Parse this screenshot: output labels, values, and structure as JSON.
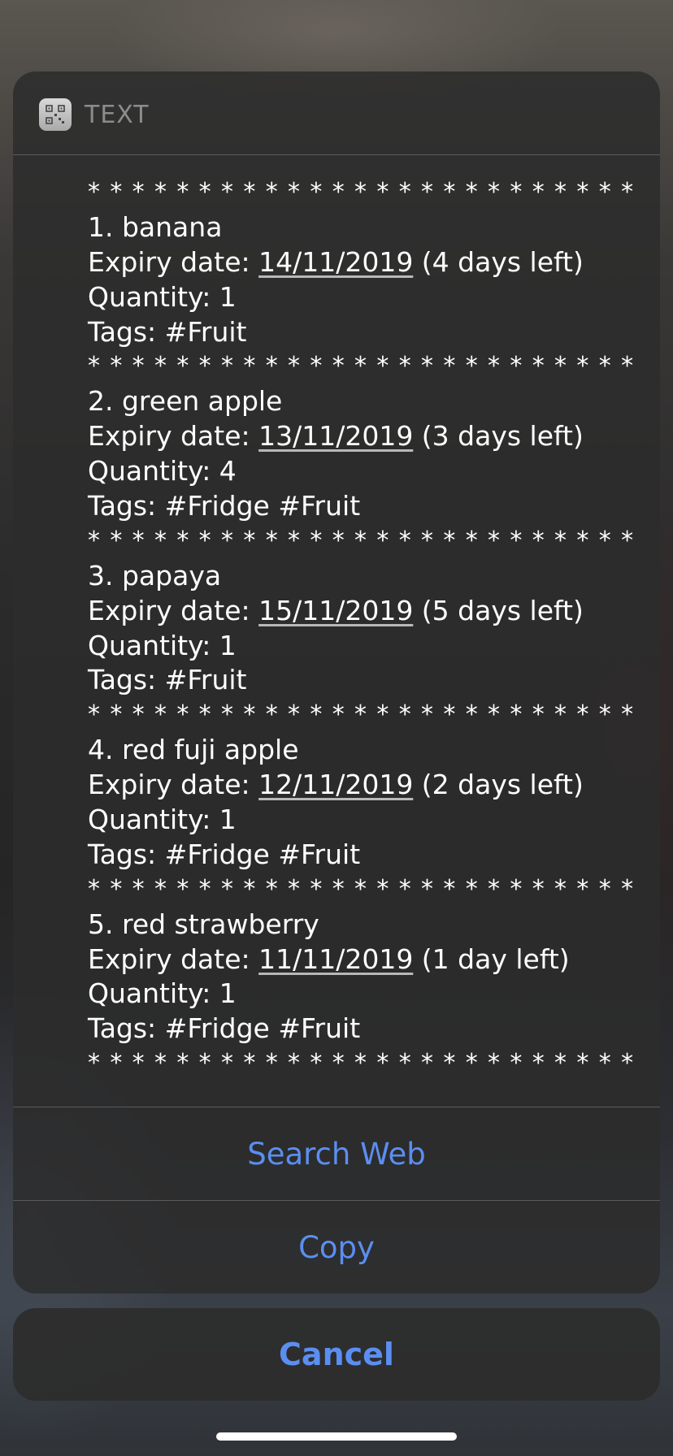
{
  "header": {
    "app_icon": "qr-code-icon",
    "title": "TEXT"
  },
  "separator": "* * * * * * * * * * * * * * * * * * * * * * * * *",
  "items": [
    {
      "name": "1. banana",
      "expiry_label": "Expiry date: ",
      "date": "14/11/2019",
      "left": " (4 days left)",
      "quantity": "Quantity: 1",
      "tags": "Tags: #Fruit"
    },
    {
      "name": "2. green apple",
      "expiry_label": "Expiry date: ",
      "date": "13/11/2019",
      "left": " (3 days left)",
      "quantity": "Quantity: 4",
      "tags": "Tags: #Fridge #Fruit"
    },
    {
      "name": "3. papaya",
      "expiry_label": "Expiry date: ",
      "date": "15/11/2019",
      "left": " (5 days left)",
      "quantity": "Quantity: 1",
      "tags": "Tags: #Fruit"
    },
    {
      "name": "4. red fuji apple",
      "expiry_label": "Expiry date: ",
      "date": "12/11/2019",
      "left": " (2 days left)",
      "quantity": "Quantity: 1",
      "tags": "Tags: #Fridge #Fruit"
    },
    {
      "name": "5. red strawberry",
      "expiry_label": "Expiry date: ",
      "date": "11/11/2019",
      "left": " (1 day left)",
      "quantity": "Quantity: 1",
      "tags": "Tags: #Fridge #Fruit"
    }
  ],
  "actions": {
    "search_web": "Search Web",
    "copy": "Copy",
    "cancel": "Cancel"
  },
  "colors": {
    "action_blue": "#5b8ef0",
    "sheet_bg": "#2c2c2c",
    "header_text": "#8c8c8c"
  }
}
